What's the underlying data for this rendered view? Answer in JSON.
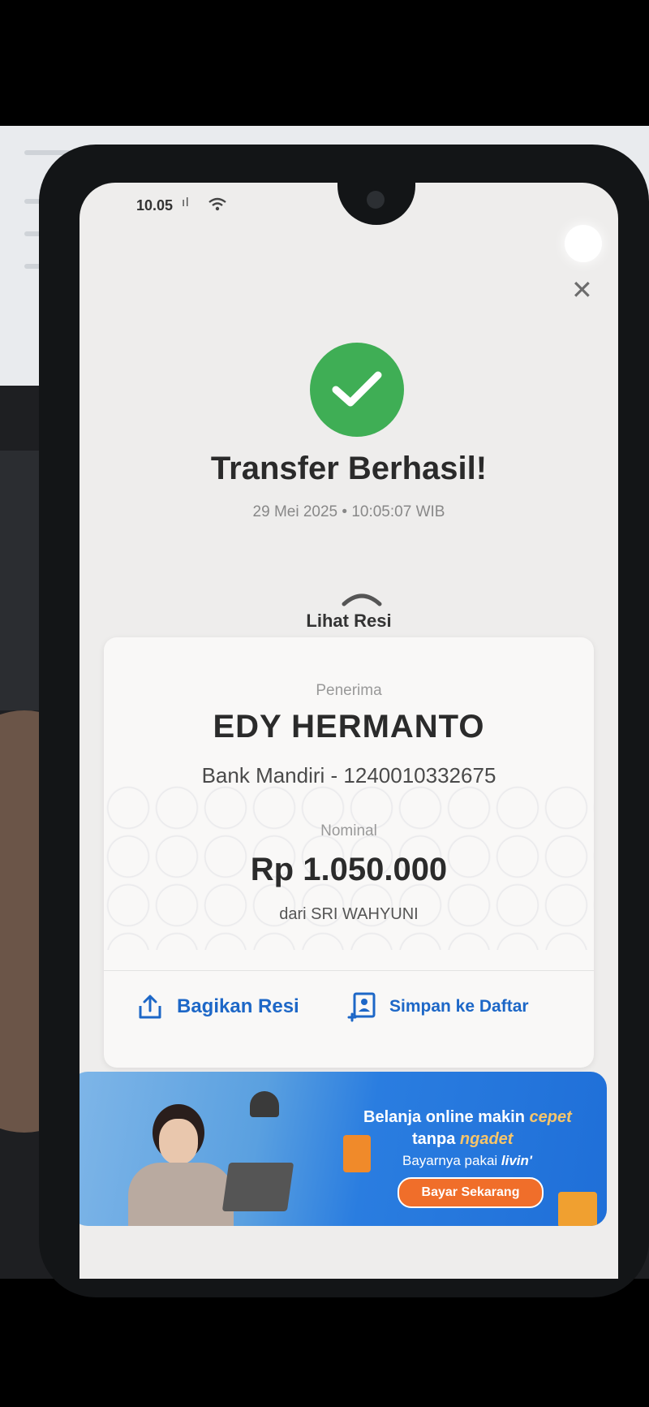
{
  "status_bar": {
    "time": "10.05",
    "signal_text": "ıl"
  },
  "result": {
    "title": "Transfer Berhasil!",
    "datetime": "29 Mei 2025 • 10:05:07 WIB",
    "receipt_toggle_label": "Lihat Resi"
  },
  "receipt": {
    "recipient_label": "Penerima",
    "recipient_name": "EDY HERMANTO",
    "recipient_bank": "Bank Mandiri - 1240010332675",
    "amount_label": "Nominal",
    "amount": "Rp 1.050.000",
    "sender": "dari SRI WAHYUNI"
  },
  "actions": {
    "share_label": "Bagikan Resi",
    "save_label": "Simpan ke Daftar"
  },
  "banner": {
    "line1_prefix": "Belanja online makin ",
    "line1_highlight": "cepet",
    "line2_prefix": "tanpa ",
    "line2_highlight": "ngadet",
    "line3_prefix": "Bayarnya pakai ",
    "line3_brand": "livin'",
    "cta_label": "Bayar Sekarang"
  },
  "colors": {
    "success_green": "#3fae55",
    "link_blue": "#1d67c7",
    "cta_orange": "#f06e2a"
  },
  "icons": [
    "check-icon",
    "close-icon",
    "chevron-up-icon",
    "share-icon",
    "add-contact-icon",
    "wifi-icon"
  ]
}
